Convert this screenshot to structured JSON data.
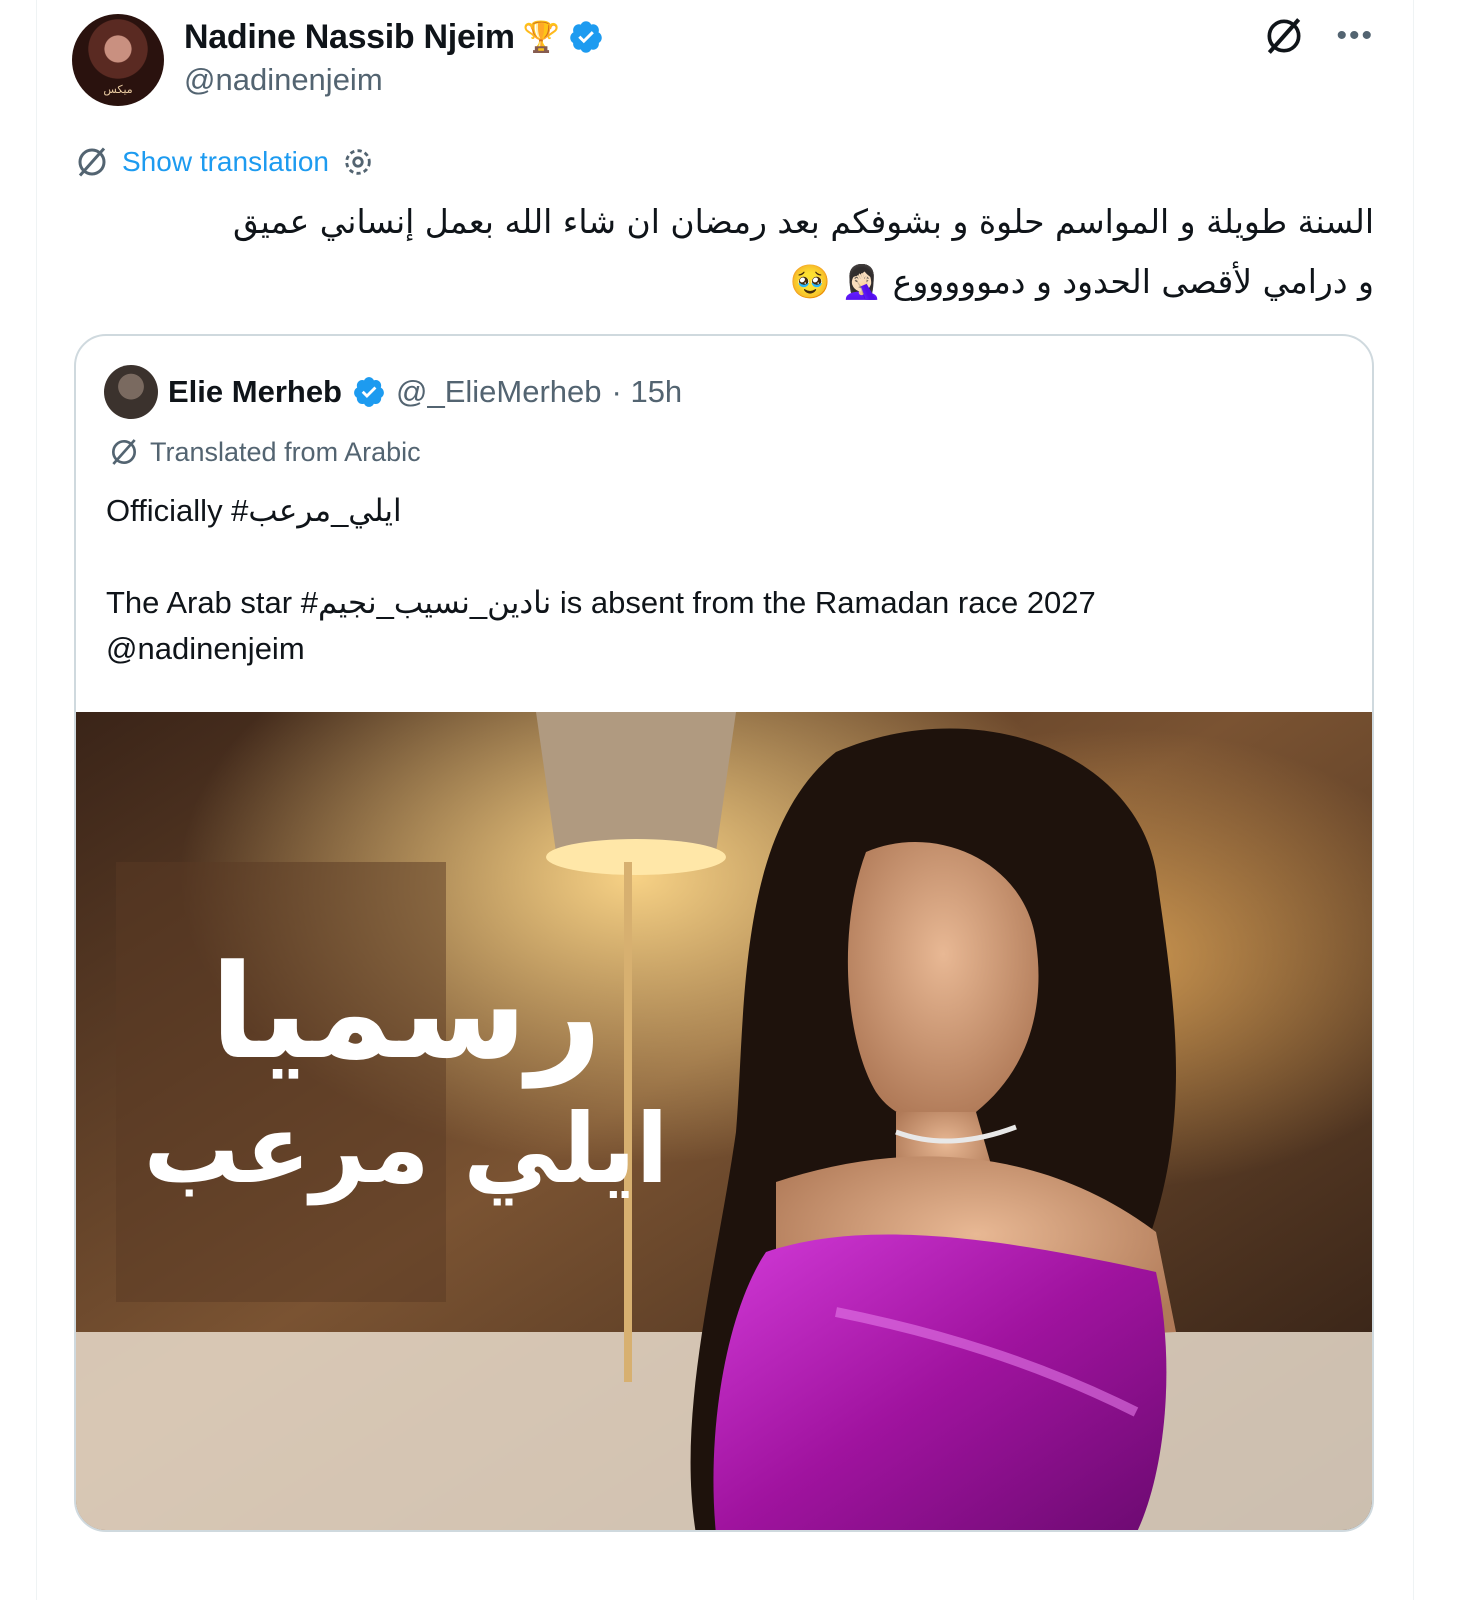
{
  "tweet": {
    "author_name": "Nadine Nassib Njeim",
    "author_emoji": "🏆",
    "author_handle": "@nadinenjeim",
    "avatar_caption": "ميكس",
    "show_translation_label": "Show translation",
    "text_line1": "السنة طويلة و المواسم حلوة  و بشوفكم بعد رمضان ان شاء الله بعمل إنساني عميق",
    "text_line2": "و درامي لأقصى الحدود و دموووووع 🤦🏻‍♀️ 🥹"
  },
  "quoted": {
    "author_name": "Elie Merheb",
    "author_handle": "@_ElieMerheb",
    "time": "· 15h",
    "translated_label": "Translated from Arabic",
    "line1": "Officially #ايلي_مرعب",
    "line2": "The Arab star #نادين_نسيب_نجيم is absent from the Ramadan race 2027",
    "line3": "@nadinenjeim",
    "image_text_big": "رسميا",
    "image_text_small": "ايلي مرعب"
  },
  "colors": {
    "verified": "#1d9bf0",
    "link": "#1d9bf0",
    "muted": "#536471",
    "dress": "#b01ab8"
  },
  "icons": [
    "grok-icon",
    "more-icon",
    "verified-icon",
    "gear-icon",
    "translate-icon"
  ]
}
